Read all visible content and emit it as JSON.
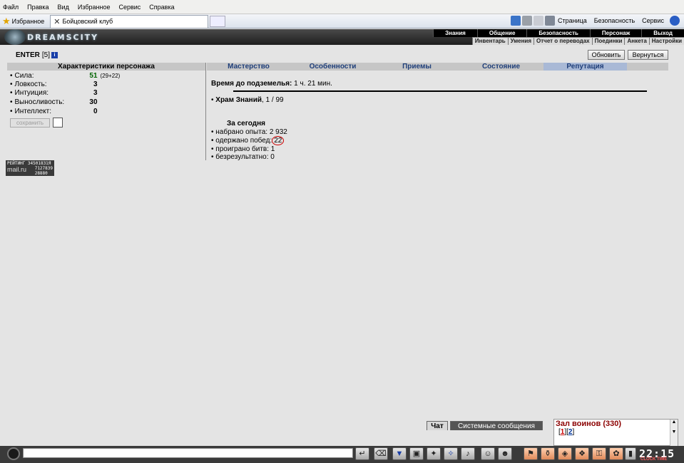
{
  "ie": {
    "menu": [
      "Файл",
      "Правка",
      "Вид",
      "Избранное",
      "Сервис",
      "Справка"
    ],
    "favorites_label": "Избранное",
    "tab_title": "Бойцовский клуб",
    "right": {
      "page": "Страница",
      "security": "Безопасность",
      "service": "Сервис"
    }
  },
  "game": {
    "logo": "DREAMSCITY",
    "nav_top": [
      "Знания",
      "Общение",
      "Безопасность",
      "Персонаж",
      "Выход"
    ],
    "nav_bottom": [
      "Инвентарь",
      "Умения",
      "Отчет о переводах",
      "Поединки",
      "Анкета",
      "Настройки"
    ]
  },
  "user": {
    "name": "ENTER",
    "level": "[5]",
    "info": "i"
  },
  "buttons": {
    "refresh": "Обновить",
    "back": "Вернуться",
    "save": "сохранить"
  },
  "char": {
    "header": "Характеристики персонажа",
    "stats": [
      {
        "name": "Сила:",
        "value": "51",
        "extra": "(29+22)"
      },
      {
        "name": "Ловкость:",
        "value": "3"
      },
      {
        "name": "Интуиция:",
        "value": "3"
      },
      {
        "name": "Выносливость:",
        "value": "30"
      },
      {
        "name": "Интеллект:",
        "value": "0"
      }
    ],
    "strength_color": "#006400"
  },
  "counter": {
    "line1": "РЕЙТИНГ 34501831Я",
    "brand": "mail.ru",
    "line2": "7127839",
    "line3": "28880"
  },
  "tabs": [
    "Мастерство",
    "Особенности",
    "Приемы",
    "Состояние",
    "Репутация"
  ],
  "active_tab": "Репутация",
  "reputation": {
    "dungeon_label": "Время до подземелья:",
    "dungeon_value": "1 ч. 21 мин.",
    "temple_label": "Храм Знаний",
    "temple_value": ", 1 / 99",
    "today_title": "За сегодня",
    "exp": "набрано опыта: 2 932",
    "wins_label": "одержано побед:",
    "wins_value": "22",
    "losses": "проиграно битв: 1",
    "draws": "безрезультатно: 0"
  },
  "chat": {
    "tab_chat": "Чат",
    "tab_system": "Системные сообщения"
  },
  "room": {
    "title": "Зал воинов (330)",
    "pages": [
      "1",
      "2"
    ],
    "current_page": "1"
  },
  "clock": {
    "time": "22:15",
    "sub": "CLOCK TIME"
  },
  "colors": {
    "accent_blue": "#1f3f7a",
    "active_tab_bg": "#a9b9d6",
    "room_title": "#8b0000"
  }
}
